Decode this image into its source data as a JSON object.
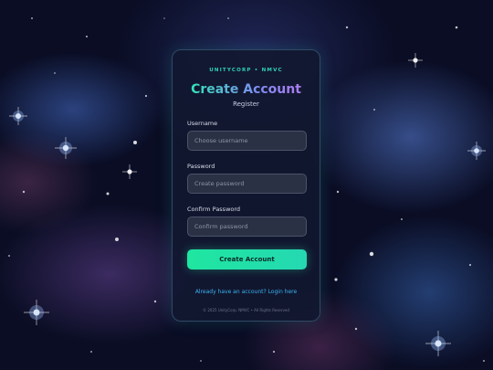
{
  "brand": "UNITYCORP • NMVC",
  "title": "Create Account",
  "subtitle": "Register",
  "fields": [
    {
      "label": "Username",
      "placeholder": "Choose username",
      "value": ""
    },
    {
      "label": "Password",
      "placeholder": "Create password",
      "value": ""
    },
    {
      "label": "Confirm Password",
      "placeholder": "Confirm password",
      "value": ""
    }
  ],
  "submit_label": "Create Account",
  "login_link": "Already have an account? Login here",
  "footer": "© 2025 UnityCorp. NMVC • All Rights Reserved",
  "colors": {
    "accent": "#25d8b2",
    "link": "#39b3f0",
    "card_background": "#121830",
    "title_gradient": [
      "#2ee8b6",
      "#b07af0"
    ]
  }
}
